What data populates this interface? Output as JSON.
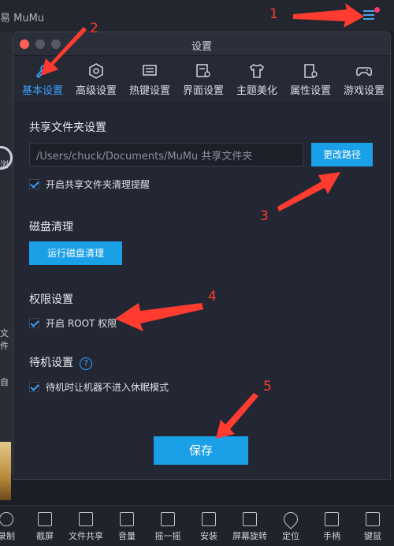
{
  "main": {
    "app_title": "易 MuMu",
    "left_fragments": [
      "浏",
      "文件",
      "自"
    ]
  },
  "dialog": {
    "title": "设置",
    "tabs": [
      {
        "label": "基本设置",
        "icon": "wrench-icon",
        "active": true
      },
      {
        "label": "高级设置",
        "icon": "hexagon-gear-icon",
        "active": false
      },
      {
        "label": "热键设置",
        "icon": "keyboard-icon",
        "active": false
      },
      {
        "label": "界面设置",
        "icon": "window-gear-icon",
        "active": false
      },
      {
        "label": "主题美化",
        "icon": "tshirt-icon",
        "active": false
      },
      {
        "label": "属性设置",
        "icon": "device-gear-icon",
        "active": false
      },
      {
        "label": "游戏设置",
        "icon": "gamepad-icon",
        "active": false
      }
    ],
    "shared_folder": {
      "title": "共享文件夹设置",
      "path_value": "/Users/chuck/Documents/MuMu 共享文件夹",
      "change_path_label": "更改路径",
      "cleanup_reminder_label": "开启共享文件夹清理提醒",
      "cleanup_reminder_checked": true
    },
    "disk_cleanup": {
      "title": "磁盘清理",
      "button_label": "运行磁盘清理"
    },
    "permissions": {
      "title": "权限设置",
      "root_label": "开启 ROOT 权限",
      "root_checked": true
    },
    "standby": {
      "title": "待机设置",
      "help_glyph": "?",
      "no_sleep_label": "待机时让机器不进入休眠模式",
      "no_sleep_checked": true
    },
    "save_label": "保存"
  },
  "bottom_bar": {
    "items": [
      "录制",
      "截屏",
      "文件共享",
      "音量",
      "摇一摇",
      "安装",
      "屏幕旋转",
      "定位",
      "手柄",
      "键鼠"
    ]
  },
  "annotations": {
    "numbers": [
      "1",
      "2",
      "3",
      "4",
      "5"
    ],
    "arrow_color": "#ff3c2f"
  },
  "colors": {
    "accent": "#1aa0e6",
    "active_tab": "#3aa0ff",
    "dialog_bg": "#232733"
  }
}
